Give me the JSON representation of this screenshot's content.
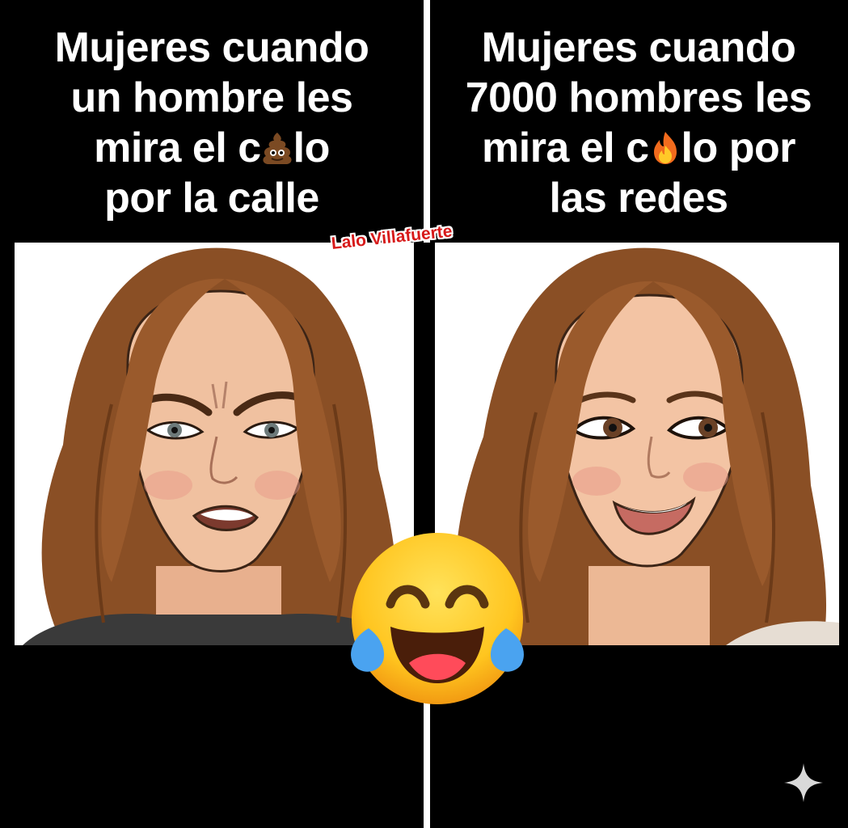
{
  "meme": {
    "left": {
      "caption_lines": [
        "Mujeres cuando",
        "un hombre les",
        "mira el c",
        "lo",
        "por la calle"
      ],
      "emoji": "poop-emoji",
      "illustration": "annoyed-woman-face"
    },
    "right": {
      "caption_lines": [
        "Mujeres cuando",
        "7000 hombres les",
        "mira el c",
        "lo por",
        "las redes"
      ],
      "emoji": "fire-emoji",
      "illustration": "smiling-woman-face"
    },
    "watermark": "Lalo Villafuerte",
    "center_emoji": "laughing-crying-emoji",
    "corner_icon": "sparkle-icon"
  },
  "colors": {
    "background": "#000000",
    "caption_text": "#ffffff",
    "watermark": "#d71a1a",
    "hair": "#9a5a2c",
    "skin": "#f0c1a0"
  }
}
